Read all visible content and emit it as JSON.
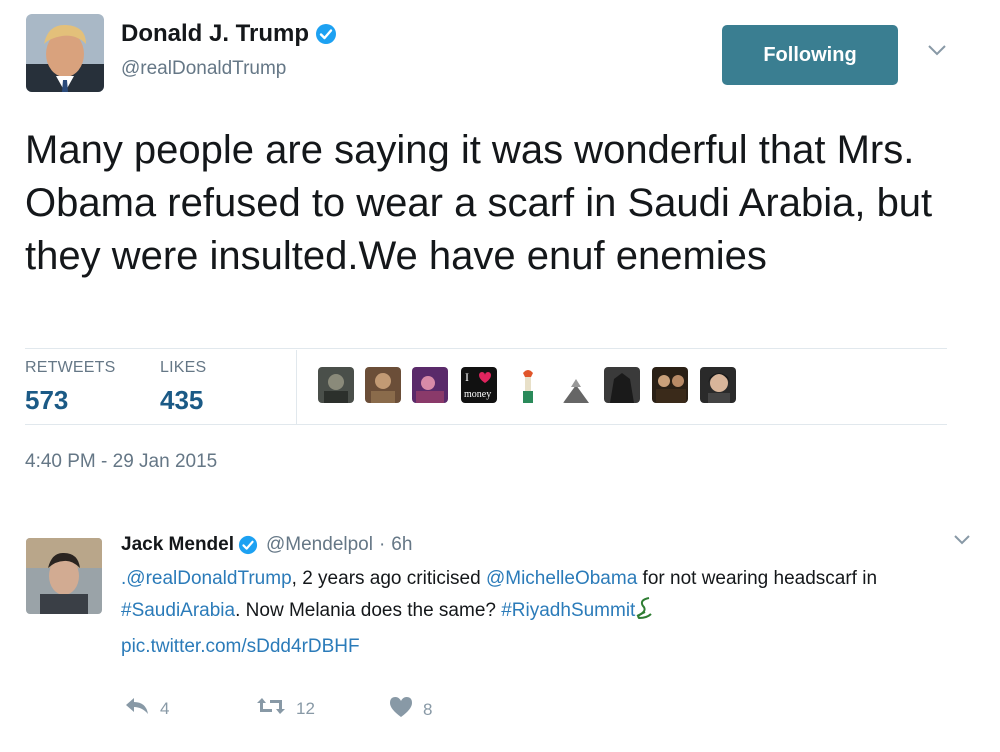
{
  "tweet": {
    "author_name": "Donald J. Trump",
    "author_handle": "@realDonaldTrump",
    "follow_label": "Following",
    "text": "Many people are saying it was wonderful that Mrs. Obama refused to wear a scarf in Saudi Arabia, but they were insulted.We have enuf enemies",
    "retweets_label": "RETWEETS",
    "retweets_count": "573",
    "likes_label": "LIKES",
    "likes_count": "435",
    "timestamp": "4:40 PM - 29 Jan 2015",
    "liker_badge_text": "I",
    "liker_badge_subtext": "money"
  },
  "reply": {
    "author_name": "Jack Mendel",
    "author_handle": "@Mendelpol",
    "separator": "·",
    "time": "6h",
    "mention1": ".@realDonaldTrump",
    "text1": ", 2 years ago criticised ",
    "mention2": "@MichelleObama",
    "text2": " for not wearing headscarf in ",
    "hashtag1": "#SaudiArabia",
    "text3": ". Now Melania does the same? ",
    "hashtag2": "#RiyadhSummit",
    "link": "pic.twitter.com/sDdd4rDBHF",
    "reply_count": "4",
    "retweet_count": "12",
    "like_count": "8"
  },
  "colors": {
    "follow_button": "#3a7e91",
    "link": "#2b7bb9",
    "stat_value": "#1b5a86",
    "muted": "#657786",
    "verified": "#1da1f2"
  },
  "icons": [
    "verified-badge-icon",
    "chevron-down-icon",
    "reply-icon",
    "retweet-icon",
    "heart-icon",
    "emoji-sword-icon"
  ]
}
